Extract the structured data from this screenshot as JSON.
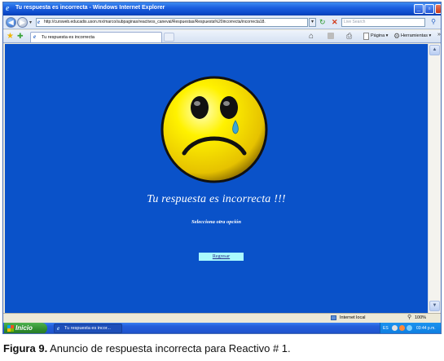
{
  "window": {
    "title": "Tu respuesta es incorrecta - Windows Internet Explorer"
  },
  "addressbar": {
    "url": "http://cursweb.educadis.uson.mx/marco/subpaginas/reactivos_caneval/Respuestas/Respuesta%20incorrecta/incorrecta18.",
    "search_placeholder": "Live Search"
  },
  "tabbar": {
    "active_tab": "Tu respuesta es incorrecta",
    "page_menu": "Página ▾",
    "tools_menu": "Herramientas ▾",
    "more": "»"
  },
  "content": {
    "message": "Tu respuesta es incorrecta !!!",
    "submessage": "Selecciona otra opción",
    "return_button": "Regresar",
    "background": "#0a52c9",
    "button_color": "#a9fafd"
  },
  "statusbar": {
    "zone": "Internet local",
    "zoom": "100%"
  },
  "taskbar": {
    "start": "Inicio",
    "task_item": "Tu respuesta es incor...",
    "lang": "ES",
    "clock": "03:44 p.m."
  },
  "caption": {
    "label": "Figura 9.",
    "text": "Anuncio de respuesta incorrecta para Reactivo # 1."
  },
  "icons": [
    "ie-icon",
    "back-arrow-icon",
    "forward-arrow-icon",
    "refresh-icon",
    "stop-icon",
    "search-icon",
    "star-icon",
    "add-favorite-icon",
    "home-icon",
    "feed-icon",
    "print-icon",
    "page-icon",
    "tools-icon",
    "sad-face-icon",
    "intranet-icon",
    "zoom-icon",
    "windows-logo-icon"
  ]
}
